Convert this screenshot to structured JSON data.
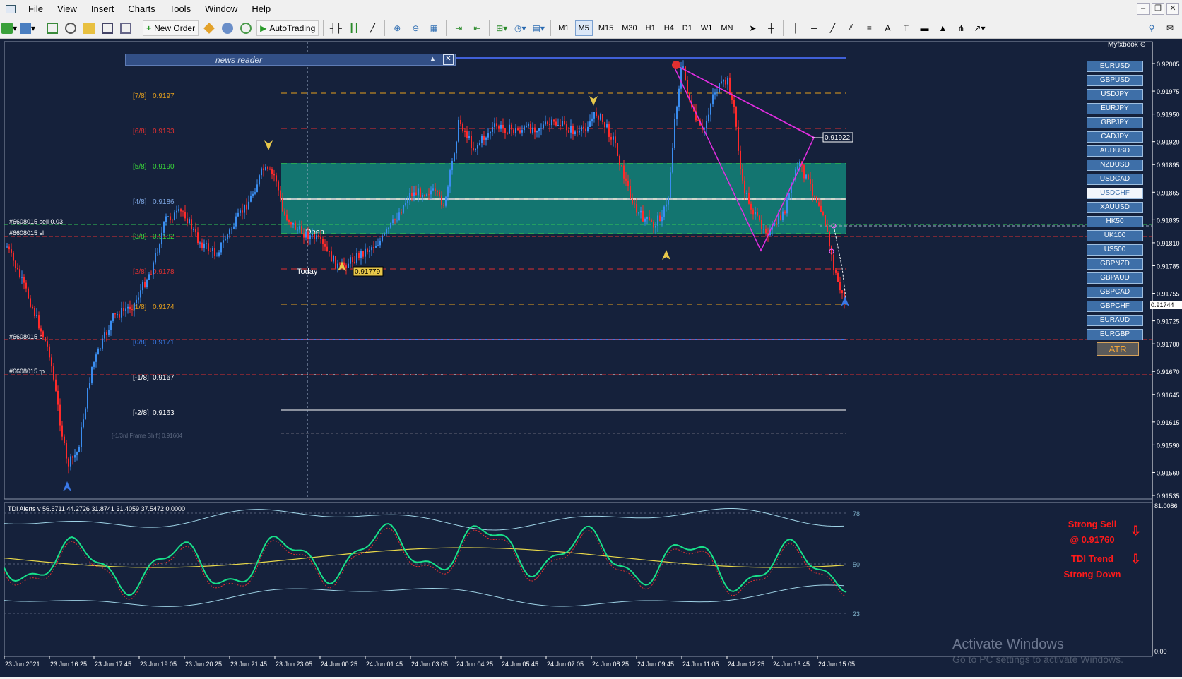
{
  "menu": [
    "File",
    "View",
    "Insert",
    "Charts",
    "Tools",
    "Window",
    "Help"
  ],
  "toolbar": {
    "new_order": "New Order",
    "autotrading": "AutoTrading",
    "timeframes": [
      "M1",
      "M5",
      "M15",
      "M30",
      "H1",
      "H4",
      "D1",
      "W1",
      "MN"
    ],
    "active_timeframe": "M5"
  },
  "chart": {
    "brand": "Myfxbook",
    "news_reader": "news reader",
    "price_axis": [
      "0.92005",
      "0.91975",
      "0.91950",
      "0.91920",
      "0.91895",
      "0.91865",
      "0.91835",
      "0.91810",
      "0.91785",
      "0.91755",
      "0.91725",
      "0.91700",
      "0.91670",
      "0.91645",
      "0.91615",
      "0.91590",
      "0.91560",
      "0.91535"
    ],
    "current_price": "0.91744",
    "target_price": "0.91922",
    "low_price": "0.91779",
    "murrey": [
      {
        "label": "[7/8]",
        "value": "0.9197",
        "color": "#e5a01e"
      },
      {
        "label": "[6/8]",
        "value": "0.9193",
        "color": "#e03030"
      },
      {
        "label": "[5/8]",
        "value": "0.9190",
        "color": "#39d839"
      },
      {
        "label": "[4/8]",
        "value": "0.9186",
        "color": "#7fa9e6"
      },
      {
        "label": "[3/8]",
        "value": "0.9182",
        "color": "#39d839"
      },
      {
        "label": "[2/8]",
        "value": "0.9178",
        "color": "#e03030"
      },
      {
        "label": "[1/8]",
        "value": "0.9174",
        "color": "#e5a01e"
      },
      {
        "label": "[0/8]",
        "value": "0.9171",
        "color": "#3a78e6"
      },
      {
        "label": "[-1/8]",
        "value": "0.9167",
        "color": "#ffffff"
      },
      {
        "label": "[-2/8]",
        "value": "0.9163",
        "color": "#ffffff"
      }
    ],
    "frame_shift": "[-1/3rd Frame Shift]  0.91604",
    "order_sell": "#6608015 sell 0.03",
    "order_sl": "#6608015 sl",
    "order_p": "#6608015 p",
    "order_tp": "#6608015 tp",
    "open_label": "Open",
    "today_label": "Today",
    "time_axis": [
      "23 Jun 2021",
      "23 Jun 16:25",
      "23 Jun 17:45",
      "23 Jun 19:05",
      "23 Jun 20:25",
      "23 Jun 21:45",
      "23 Jun 23:05",
      "24 Jun 00:25",
      "24 Jun 01:45",
      "24 Jun 03:05",
      "24 Jun 04:25",
      "24 Jun 05:45",
      "24 Jun 07:05",
      "24 Jun 08:25",
      "24 Jun 09:45",
      "24 Jun 11:05",
      "24 Jun 12:25",
      "24 Jun 13:45",
      "24 Jun 15:05"
    ]
  },
  "symbols": [
    "EURUSD",
    "GBPUSD",
    "USDJPY",
    "EURJPY",
    "GBPJPY",
    "CADJPY",
    "AUDUSD",
    "NZDUSD",
    "USDCAD",
    "USDCHF",
    "XAUUSD",
    "HK50",
    "UK100",
    "US500",
    "GBPNZD",
    "GBPAUD",
    "GBPCAD",
    "GBPCHF",
    "EURAUD",
    "EURGBP"
  ],
  "selected_symbol": "USDCHF",
  "atr_label": "ATR",
  "indicator": {
    "title": "TDI Alerts v 56.6711 44.2726 31.8741 31.4059 37.5472 0.0000",
    "levels": [
      "78",
      "50",
      "23"
    ],
    "axis_top": "81.0086",
    "axis_bottom": "0.00",
    "signal_line1": "Strong Sell",
    "signal_line2": "@ 0.91760",
    "trend_line1": "TDI Trend",
    "trend_line2": "Strong Down"
  },
  "watermark": {
    "line1": "Activate Windows",
    "line2": "Go to PC settings to activate Windows."
  },
  "colors": {
    "bg": "#15213b",
    "bull": "#3a8df0",
    "bear": "#ff2a2a",
    "zone": "#13847a",
    "pattern": "#e02ee0",
    "tdi": "#18e08a"
  }
}
